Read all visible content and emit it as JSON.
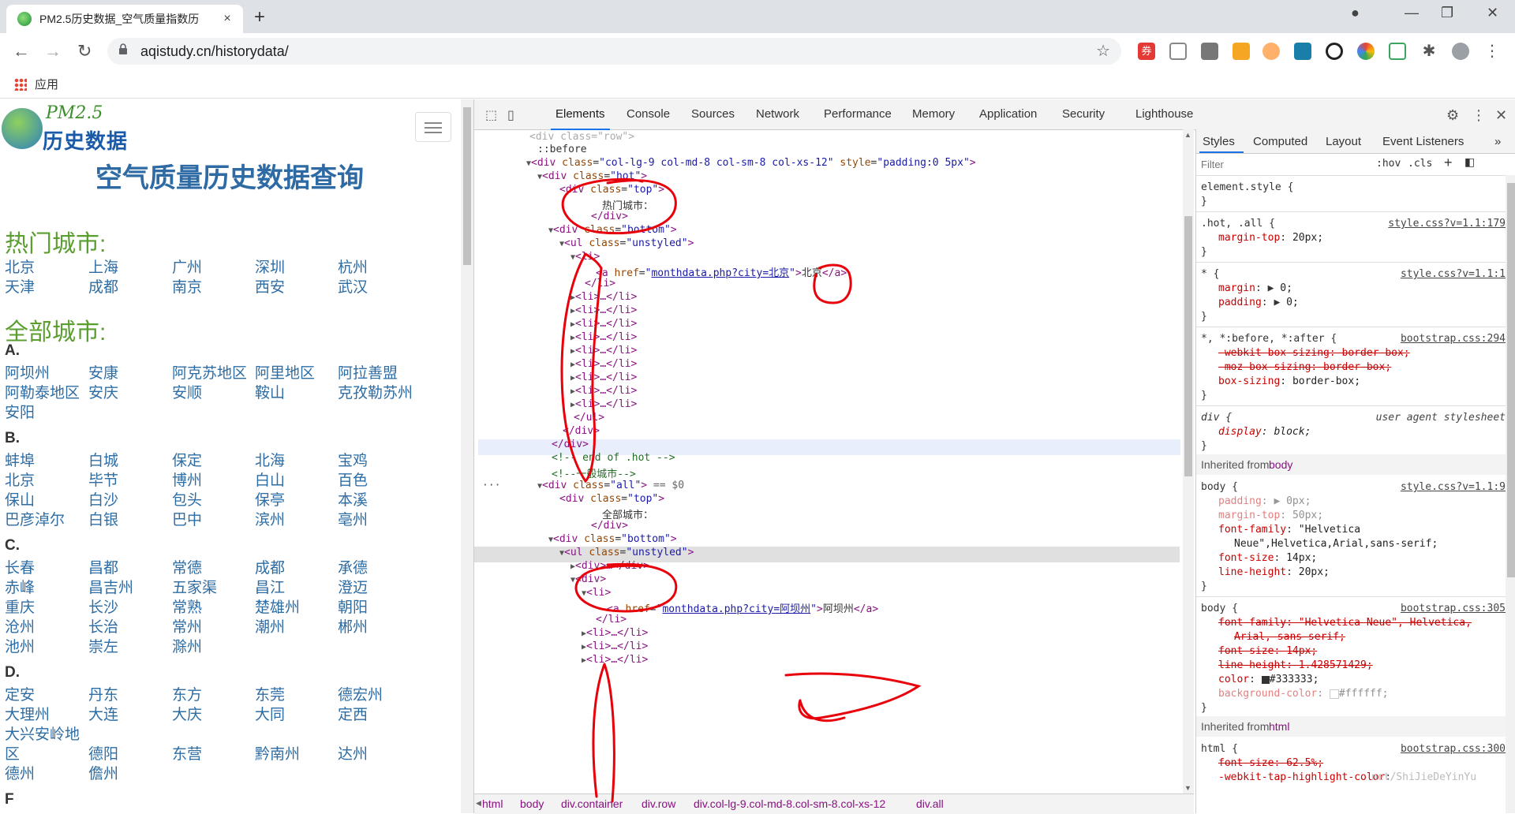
{
  "browser": {
    "tab_title": "PM2.5历史数据_空气质量指数历",
    "tab_close": "×",
    "new_tab": "+",
    "url": "aqistudy.cn/historydata/",
    "bookmarks_apps": "应用",
    "ext_badge": "券"
  },
  "page": {
    "logo_pm": "PM2.5",
    "logo_text": "历史数据",
    "title": "空气质量历史数据查询",
    "hot_title": "热门城市:",
    "all_title": "全部城市:",
    "hot_cities": [
      [
        "北京",
        "上海",
        "广州",
        "深圳",
        "杭州"
      ],
      [
        "天津",
        "成都",
        "南京",
        "西安",
        "武汉"
      ]
    ],
    "groups": [
      {
        "letter": "A.",
        "rows": [
          [
            "阿坝州",
            "安康",
            "阿克苏地区",
            "阿里地区",
            "阿拉善盟"
          ],
          [
            "阿勒泰地区",
            "安庆",
            "安顺",
            "鞍山",
            "克孜勒苏州"
          ],
          [
            "安阳"
          ]
        ]
      },
      {
        "letter": "B.",
        "rows": [
          [
            "蚌埠",
            "白城",
            "保定",
            "北海",
            "宝鸡"
          ],
          [
            "北京",
            "毕节",
            "博州",
            "白山",
            "百色"
          ],
          [
            "保山",
            "白沙",
            "包头",
            "保亭",
            "本溪"
          ],
          [
            "巴彦淖尔",
            "白银",
            "巴中",
            "滨州",
            "亳州"
          ]
        ]
      },
      {
        "letter": "C.",
        "rows": [
          [
            "长春",
            "昌都",
            "常德",
            "成都",
            "承德"
          ],
          [
            "赤峰",
            "昌吉州",
            "五家渠",
            "昌江",
            "澄迈"
          ],
          [
            "重庆",
            "长沙",
            "常熟",
            "楚雄州",
            "朝阳"
          ],
          [
            "沧州",
            "长治",
            "常州",
            "潮州",
            "郴州"
          ],
          [
            "池州",
            "崇左",
            "滁州"
          ]
        ]
      },
      {
        "letter": "D.",
        "rows": [
          [
            "定安",
            "丹东",
            "东方",
            "东莞",
            "德宏州"
          ],
          [
            "大理州",
            "大连",
            "大庆",
            "大同",
            "定西"
          ],
          [
            "大兴安岭地"
          ],
          [
            "区",
            "德阳",
            "东营",
            "黔南州",
            "达州"
          ],
          [
            "德州",
            "儋州"
          ]
        ]
      },
      {
        "letter": "F",
        "rows": []
      }
    ]
  },
  "devtools": {
    "tabs": [
      "Elements",
      "Console",
      "Sources",
      "Network",
      "Performance",
      "Memory",
      "Application",
      "Security",
      "Lighthouse"
    ],
    "dom_lines": {
      "l1": "::before",
      "l2_class": "col-lg-9 col-md-8 col-sm-8 col-xs-12",
      "l2_style": "padding:0 5px",
      "hot_class": "hot",
      "top_class": "top",
      "hot_text": "热门城市：",
      "bottom_class": "bottom",
      "ul_class": "unstyled",
      "href1": "monthdata.php?city=北京",
      "link1_text": "北京",
      "comment1": "<!-- end of .hot -->",
      "comment2": "<!--一般城市-->",
      "all_class": "all",
      "eq": " == $0",
      "all_text": "全部城市：",
      "href2": "monthdata.php?city=阿坝州",
      "link2_text": "阿坝州",
      "li_collapsed": "<li>…</li>",
      "div_collapsed": "<div>…</div>"
    },
    "breadcrumbs": [
      "html",
      "body",
      "div.container",
      "div.row",
      "div.col-lg-9.col-md-8.col-sm-8.col-xs-12",
      "div.all"
    ],
    "styles_tabs": [
      "Styles",
      "Computed",
      "Layout",
      "Event Listeners"
    ],
    "filter_placeholder": "Filter",
    "hov": ":hov",
    "cls": ".cls",
    "rules": {
      "element_style": "element.style {",
      "r1_sel": ".hot, .all {",
      "r1_src": "style.css?v=1.1:179",
      "r1_p1": "margin-top",
      "r1_v1": "20px;",
      "r2_sel": "* {",
      "r2_src": "style.css?v=1.1:1",
      "r2_p1": "margin",
      "r2_v1": "0;",
      "r2_p2": "padding",
      "r2_v2": "0;",
      "r3_sel": "*, *:before, *:after {",
      "r3_src": "bootstrap.css:294",
      "r3_p1": "-webkit-box-sizing: border-box;",
      "r3_p2": "-moz-box-sizing: border-box;",
      "r3_p3": "box-sizing",
      "r3_v3": "border-box;",
      "r4_sel": "div {",
      "r4_src": "user agent stylesheet",
      "r4_p1": "display",
      "r4_v1": "block;",
      "inh_body": "Inherited from",
      "inh_body_tag": "body",
      "r5_sel": "body {",
      "r5_src": "style.css?v=1.1:9",
      "r5_p1": "padding",
      "r5_v1": "0px;",
      "r5_p2": "margin-top",
      "r5_v2": "50px;",
      "r5_p3": "font-family",
      "r5_v3": "\"Helvetica",
      "r5_v3b": "Neue\",Helvetica,Arial,sans-serif;",
      "r5_p4": "font-size",
      "r5_v4": "14px;",
      "r5_p5": "line-height",
      "r5_v5": "20px;",
      "r6_sel": "body {",
      "r6_src": "bootstrap.css:305",
      "r6_p1": "font-family: \"Helvetica Neue\", Helvetica,",
      "r6_p1b": "Arial, sans-serif;",
      "r6_p2": "font-size: 14px;",
      "r6_p3": "line-height: 1.428571429;",
      "r6_p4": "color",
      "r6_v4": "#333333;",
      "r6_p5": "background-color",
      "r6_v5": "#ffffff;",
      "inh_html_tag": "html",
      "r7_sel": "html {",
      "r7_src": "bootstrap.css:300",
      "r7_p1": "font-size: 62.5%;",
      "r7_p2": "-webkit-tap-highlight-color",
      "r7_wm": "net/ShiJieDeYinYu"
    }
  },
  "colors": {
    "accent": "#1a73e8",
    "annotation": "#e8000b",
    "link": "#2e6da4",
    "section": "#5a9e2f"
  }
}
